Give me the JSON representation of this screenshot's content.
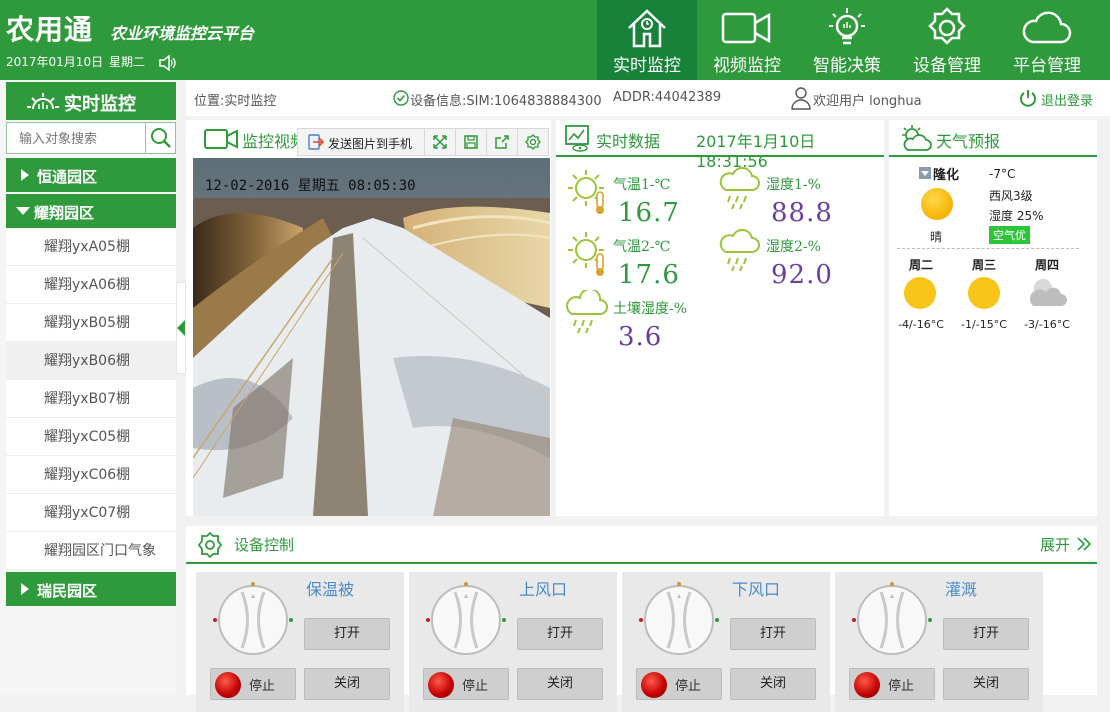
{
  "header": {
    "logo": "农用通",
    "subtitle": "农业环境监控云平台",
    "date": "2017年01月10日",
    "weekday": "星期二",
    "nav": [
      {
        "label": "实时监控",
        "icon": "home-icon",
        "active": true
      },
      {
        "label": "视频监控",
        "icon": "video-camera-icon"
      },
      {
        "label": "智能决策",
        "icon": "lightbulb-icon"
      },
      {
        "label": "设备管理",
        "icon": "gear-icon"
      },
      {
        "label": "平台管理",
        "icon": "cloud-icon"
      }
    ],
    "accent": "#2e9a3c"
  },
  "sidebar": {
    "title": "实时监控",
    "search_placeholder": "输入对象搜索",
    "groups": [
      {
        "label": "恒通园区",
        "expanded": false
      },
      {
        "label": "耀翔园区",
        "expanded": true
      },
      {
        "label": "瑞民园区",
        "expanded": false
      }
    ],
    "items": [
      "耀翔yxA05棚",
      "耀翔yxA06棚",
      "耀翔yxB05棚",
      "耀翔yxB06棚",
      "耀翔yxB07棚",
      "耀翔yxC05棚",
      "耀翔yxC06棚",
      "耀翔yxC07棚",
      "耀翔园区门口气象"
    ]
  },
  "info": {
    "location": "位置:实时监控",
    "device": "设备信息:SIM:1064838884300",
    "addr": "ADDR:44042389",
    "welcome": "欢迎用户 longhua",
    "logout": "退出登录"
  },
  "video": {
    "title": "监控视频",
    "send_label": "发送图片到手机",
    "overlay": "12-02-2016 星期五 08:05:30"
  },
  "realtime": {
    "title": "实时数据",
    "datetime": "2017年1月10日 18:31:56",
    "sensors": [
      {
        "label": "气温1-℃",
        "value": "16.7",
        "icon": "sun-thermometer-icon",
        "color": "#2e9a3c"
      },
      {
        "label": "湿度1-%",
        "value": "88.8",
        "icon": "rain-cloud-icon",
        "color": "#6b3fa0"
      },
      {
        "label": "气温2-℃",
        "value": "17.6",
        "icon": "sun-thermometer-icon",
        "color": "#2e9a3c"
      },
      {
        "label": "湿度2-%",
        "value": "92.0",
        "icon": "rain-cloud-icon",
        "color": "#6b3fa0"
      },
      {
        "label": "土壤湿度-%",
        "value": "3.6",
        "icon": "soil-cloud-icon",
        "color": "#6b3fa0"
      }
    ]
  },
  "weather": {
    "title": "天气预报",
    "city": "隆化",
    "temp": "-7°C",
    "wind": "西风3级",
    "humidity": "湿度 25%",
    "condition": "晴",
    "air": "空气优",
    "forecast": [
      {
        "day": "周二",
        "range": "-4/-16°C",
        "icon": "sun-icon"
      },
      {
        "day": "周三",
        "range": "-1/-15°C",
        "icon": "sun-icon"
      },
      {
        "day": "周四",
        "range": "-3/-16°C",
        "icon": "cloudy-icon"
      }
    ]
  },
  "control": {
    "title": "设备控制",
    "expand": "展开",
    "devices": [
      {
        "name": "保温被",
        "open": "打开",
        "stop": "停止",
        "close": "关闭"
      },
      {
        "name": "上风口",
        "open": "打开",
        "stop": "停止",
        "close": "关闭"
      },
      {
        "name": "下风口",
        "open": "打开",
        "stop": "停止",
        "close": "关闭"
      },
      {
        "name": "灌溉",
        "open": "打开",
        "stop": "停止",
        "close": "关闭"
      }
    ]
  }
}
